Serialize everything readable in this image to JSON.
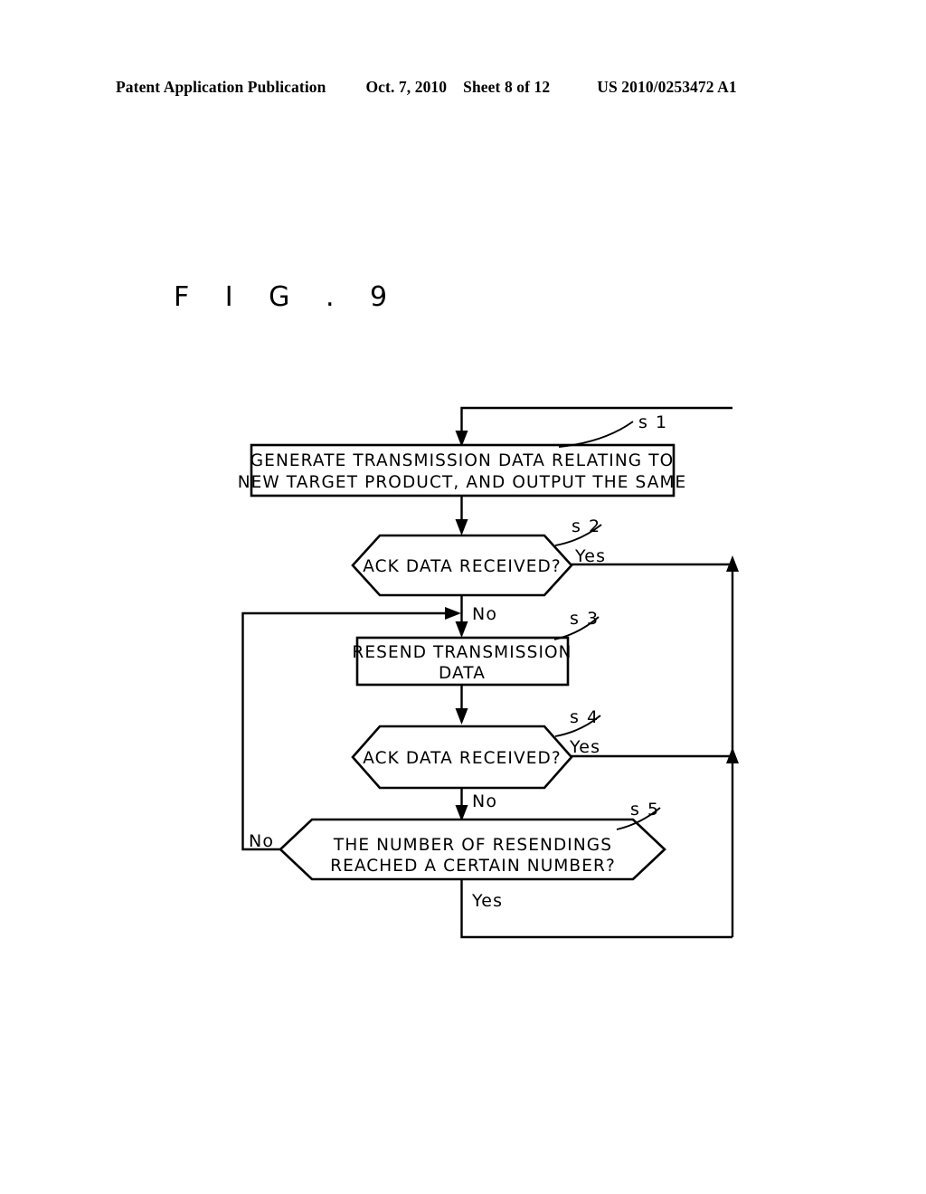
{
  "header": {
    "publication": "Patent Application Publication",
    "date": "Oct. 7, 2010",
    "sheet": "Sheet 8 of 12",
    "document_number": "US 2010/0253472 A1"
  },
  "figure": {
    "title": "F I G . 9"
  },
  "flowchart": {
    "nodes": [
      {
        "id": "s1",
        "kind": "process",
        "step_label": "s 1",
        "lines": [
          "GENERATE TRANSMISSION DATA RELATING TO",
          "NEW TARGET PRODUCT, AND OUTPUT THE SAME"
        ]
      },
      {
        "id": "s2",
        "kind": "decision",
        "step_label": "s 2",
        "lines": [
          "ACK DATA RECEIVED?"
        ],
        "yes_label": "Yes",
        "no_label": "No"
      },
      {
        "id": "s3",
        "kind": "process",
        "step_label": "s 3",
        "lines": [
          "RESEND TRANSMISSION",
          "DATA"
        ]
      },
      {
        "id": "s4",
        "kind": "decision",
        "step_label": "s 4",
        "lines": [
          "ACK DATA RECEIVED?"
        ],
        "yes_label": "Yes",
        "no_label": "No"
      },
      {
        "id": "s5",
        "kind": "decision",
        "step_label": "s 5",
        "lines": [
          "THE NUMBER OF RESENDINGS",
          "REACHED A CERTAIN NUMBER?"
        ],
        "yes_label": "Yes",
        "no_label": "No"
      }
    ]
  },
  "colors": {
    "ink": "#000000",
    "paper": "#ffffff"
  }
}
